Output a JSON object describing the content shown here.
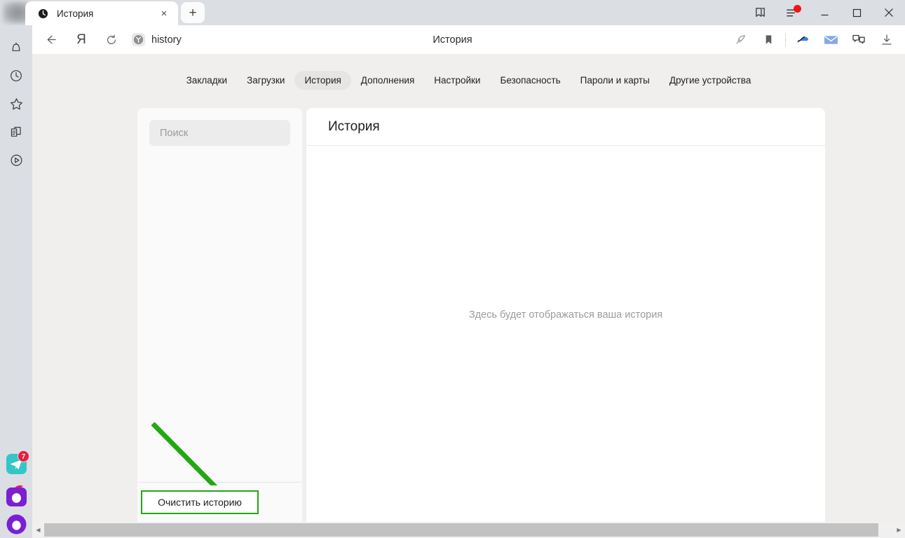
{
  "window": {
    "tab": {
      "title": "История",
      "favicon": "clock-icon",
      "close_label": "×"
    },
    "new_tab_label": "+",
    "controls": {
      "collections_label": "collections-icon",
      "menu_label": "menu-icon",
      "minimize_label": "—",
      "maximize_label": "□",
      "close_label": "×"
    }
  },
  "toolbar": {
    "back_label": "←",
    "yandex_label": "Я",
    "reload_label": "⟳",
    "url": "history",
    "url_favicon": "yandex-y-icon",
    "page_title": "История",
    "right_icons": [
      "rocket-icon",
      "bookmark-icon",
      "yandex-cloud-icon",
      "mail-icon",
      "messenger-icon",
      "downloads-icon"
    ]
  },
  "os_sidebar": {
    "icons": [
      "bell-icon",
      "clock-icon",
      "star-icon",
      "documents-icon",
      "play-circle-icon"
    ],
    "apps": [
      {
        "name": "telegram-icon",
        "badge": "7"
      },
      {
        "name": "viber-icon",
        "badge": ""
      },
      {
        "name": "viber-round-icon",
        "badge": ""
      }
    ]
  },
  "nav": {
    "tabs": [
      {
        "label": "Закладки",
        "active": false
      },
      {
        "label": "Загрузки",
        "active": false
      },
      {
        "label": "История",
        "active": true
      },
      {
        "label": "Дополнения",
        "active": false
      },
      {
        "label": "Настройки",
        "active": false
      },
      {
        "label": "Безопасность",
        "active": false
      },
      {
        "label": "Пароли и карты",
        "active": false
      },
      {
        "label": "Другие устройства",
        "active": false
      }
    ]
  },
  "left_panel": {
    "search_placeholder": "Поиск",
    "search_value": "",
    "clear_button_label": "Очистить историю"
  },
  "main_panel": {
    "title": "История",
    "empty_message": "Здесь будет отображаться ваша история"
  },
  "annotation": {
    "arrow_color": "#22a812",
    "highlight_color": "#22a812"
  },
  "scrollbar": {
    "left_arrow": "◀",
    "right_arrow": "▶"
  }
}
